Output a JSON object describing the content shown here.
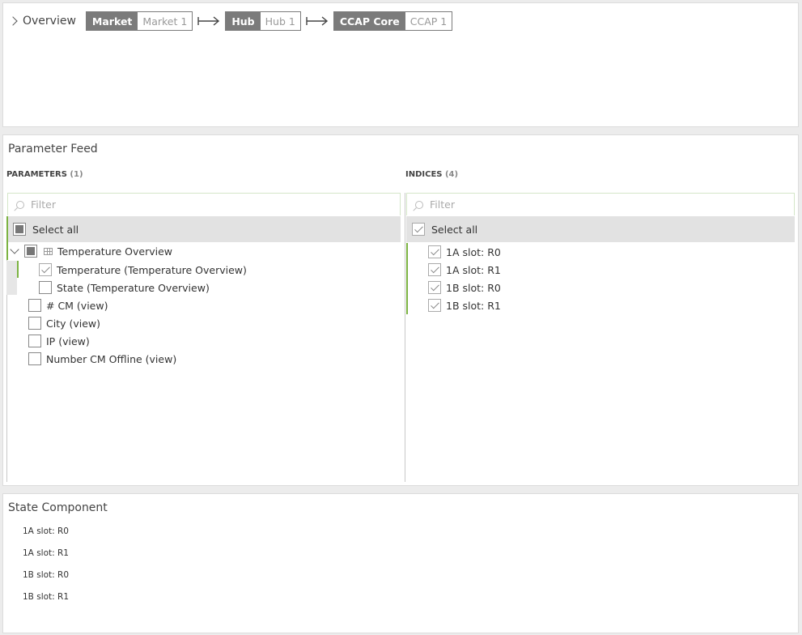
{
  "breadcrumb": {
    "overview_label": "Overview",
    "segments": [
      {
        "key": "Market",
        "value": "Market 1"
      },
      {
        "key": "Hub",
        "value": "Hub 1"
      },
      {
        "key": "CCAP Core",
        "value": "CCAP 1"
      }
    ]
  },
  "parameter_feed": {
    "title": "Parameter Feed",
    "parameters": {
      "heading": "PARAMETERS",
      "count": "(1)",
      "filter_placeholder": "Filter",
      "select_all": "Select all",
      "group": {
        "label": "Temperature Overview",
        "children": [
          {
            "label": "Temperature (Temperature Overview)",
            "checked": true
          },
          {
            "label": "State (Temperature Overview)",
            "checked": false
          }
        ]
      },
      "items": [
        {
          "label": "# CM (view)"
        },
        {
          "label": "City (view)"
        },
        {
          "label": "IP (view)"
        },
        {
          "label": "Number CM Offline (view)"
        }
      ]
    },
    "indices": {
      "heading": "INDICES",
      "count": "(4)",
      "filter_placeholder": "Filter",
      "select_all": "Select all",
      "items": [
        {
          "label": "1A slot: R0"
        },
        {
          "label": "1A slot: R1"
        },
        {
          "label": "1B slot: R0"
        },
        {
          "label": "1B slot: R1"
        }
      ]
    }
  },
  "state_component": {
    "title": "State Component",
    "rows": [
      "1A slot: R0",
      "1A slot: R1",
      "1B slot: R0",
      "1B slot: R1"
    ]
  },
  "colors": {
    "accent_green": "#7cb342",
    "pill_grey": "#7b7b7b",
    "select_all_bg": "#e2e2e2"
  }
}
